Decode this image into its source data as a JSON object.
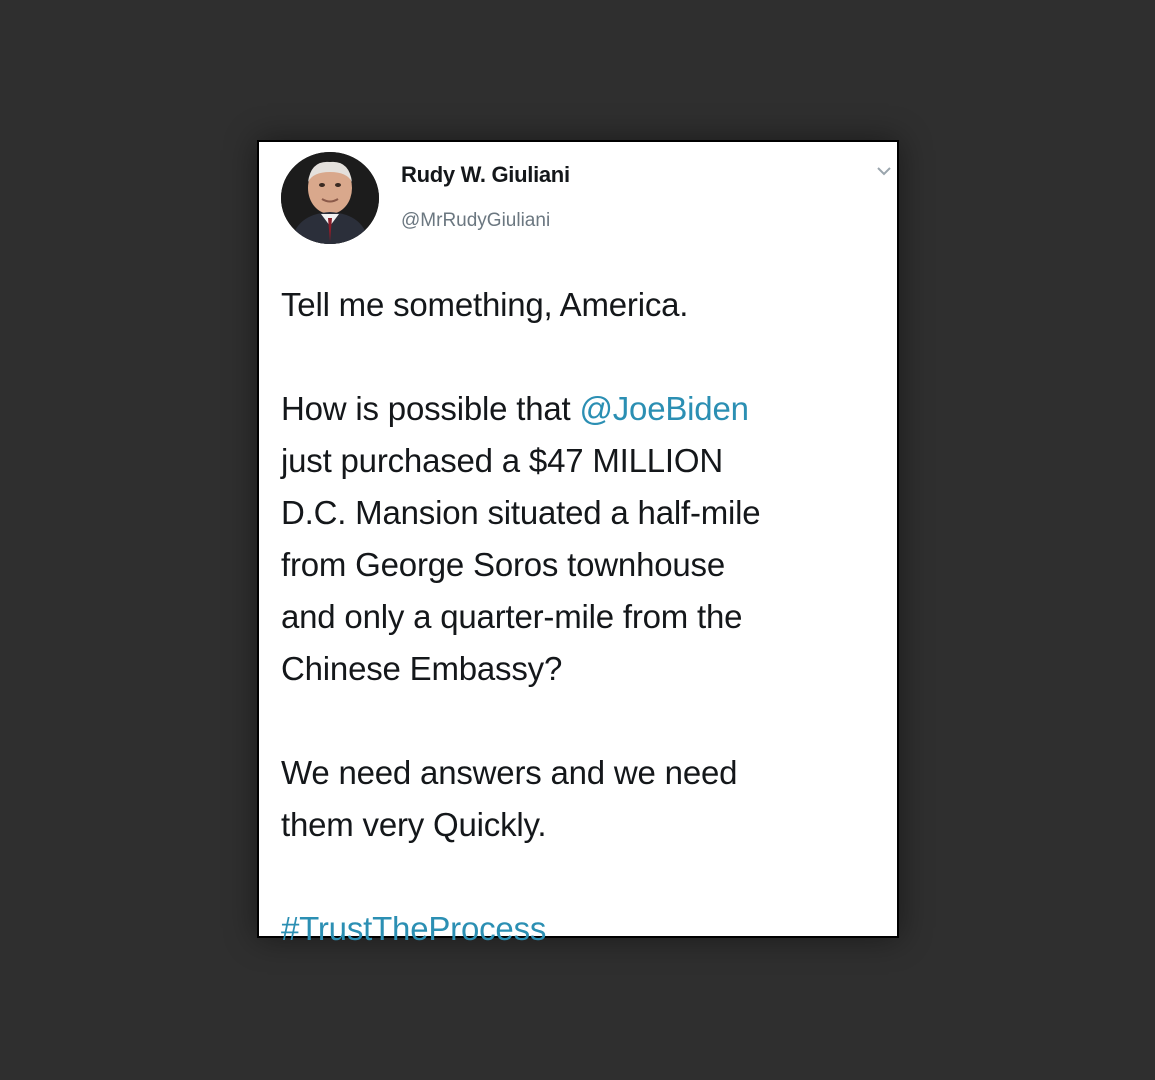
{
  "tweet": {
    "author": {
      "display_name": "Rudy W. Giuliani",
      "handle": "@MrRudyGiuliani",
      "avatar_icon": "profile-photo"
    },
    "menu_icon": "chevron-down-icon",
    "body": {
      "line1": "Tell me something, America.",
      "p2_prefix": "How is possible that ",
      "mention": "@JoeBiden",
      "p2_line2": "just purchased a $47 MILLION",
      "p2_line3": "D.C. Mansion situated a half-mile",
      "p2_line4": "from George Soros townhouse",
      "p2_line5": "and only a quarter-mile from the",
      "p2_line6": "Chinese Embassy?",
      "p3_line1": "We need answers and we need",
      "p3_line2": "them very Quickly.",
      "hashtag": "#TrustTheProcess"
    },
    "colors": {
      "link": "#2b8fb3",
      "text": "#14171a",
      "handle": "#6b7780",
      "background": "#2f2f2f"
    }
  }
}
